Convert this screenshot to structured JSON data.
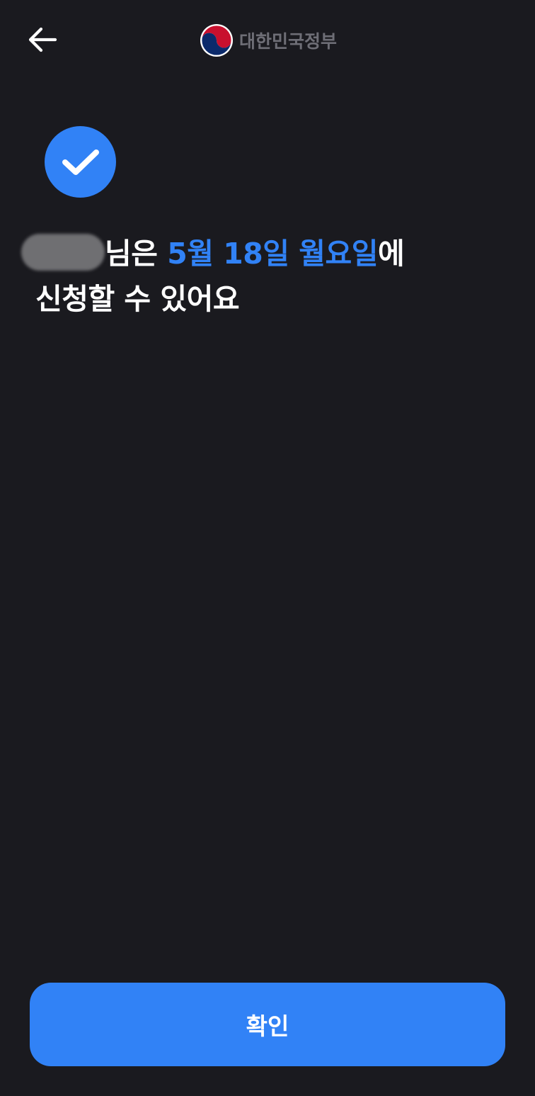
{
  "header": {
    "back_icon": "arrow-left-icon",
    "brand_logo": "korea-government-emblem-icon",
    "brand_name": "대한민국정부"
  },
  "status_icon": "check-circle-icon",
  "message": {
    "name_suffix": "님은 ",
    "date": "5월 18일 월요일",
    "after_date": "에",
    "line2": "신청할 수 있어요"
  },
  "actions": {
    "confirm_label": "확인"
  },
  "colors": {
    "background": "#1a1a1f",
    "accent": "#3182f6",
    "brand_text": "#6e6e76",
    "text": "#ffffff"
  }
}
